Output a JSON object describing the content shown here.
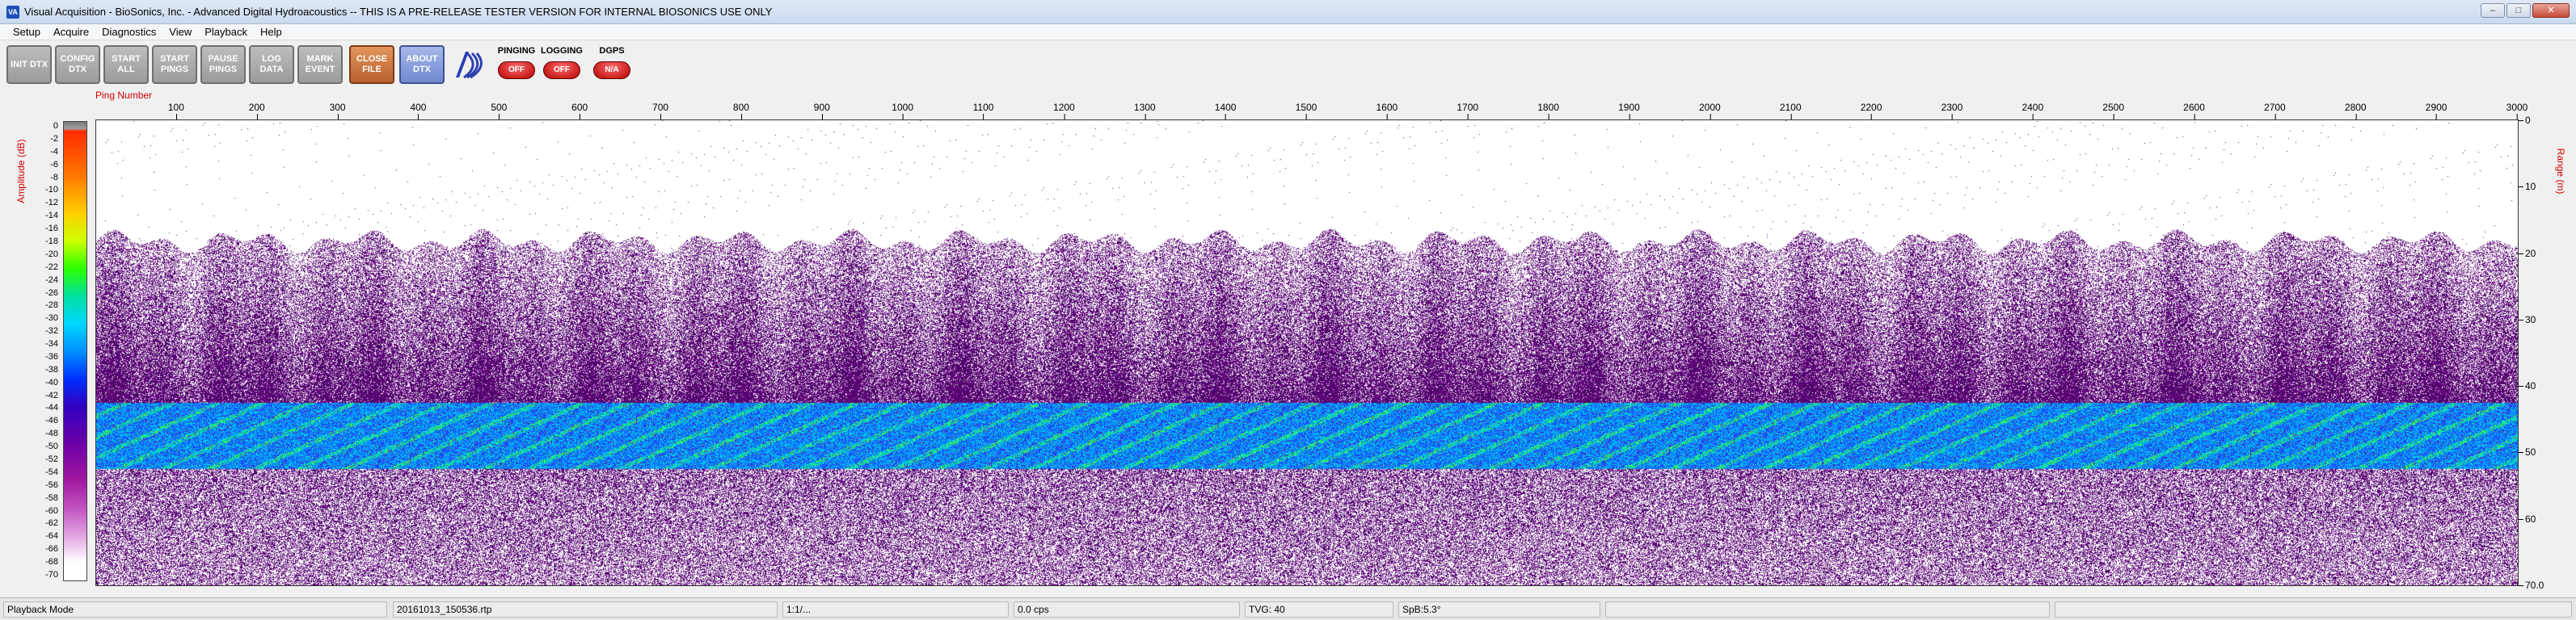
{
  "window": {
    "icon_text": "VA",
    "title": "Visual Acquisition  -  BioSonics, Inc.  -  Advanced Digital Hydroacoustics  --  THIS IS A PRE-RELEASE TESTER VERSION FOR INTERNAL BIOSONICS USE ONLY",
    "controls": [
      "–",
      "□",
      "✕"
    ]
  },
  "menu": [
    "Setup",
    "Acquire",
    "Diagnostics",
    "View",
    "Playback",
    "Help"
  ],
  "toolbar": {
    "buttons": [
      {
        "label": "INIT DTX",
        "name": "init-dtx-button"
      },
      {
        "label": "CONFIG DTX",
        "name": "config-dtx-button"
      },
      {
        "label": "START ALL",
        "name": "start-all-button"
      },
      {
        "label": "START PINGS",
        "name": "start-pings-button"
      },
      {
        "label": "PAUSE PINGS",
        "name": "pause-pings-button"
      },
      {
        "label": "LOG DATA",
        "name": "log-data-button"
      },
      {
        "label": "MARK EVENT",
        "name": "mark-event-button"
      },
      {
        "label": "CLOSE FILE",
        "name": "close-file-button"
      },
      {
        "label": "ABOUT DTX",
        "name": "about-dtx-button"
      }
    ],
    "indicators": [
      {
        "label": "PINGING",
        "value": "OFF"
      },
      {
        "label": "LOGGING",
        "value": "OFF"
      },
      {
        "label": "DGPS",
        "value": "N/A"
      }
    ]
  },
  "plot": {
    "x_axis_title": "Ping Number",
    "y_left_title": "Amplitude (dB)",
    "y_right_title": "Range (m)",
    "x_ticks": [
      "100",
      "200",
      "300",
      "400",
      "500",
      "600",
      "700",
      "800",
      "900",
      "1000",
      "1100",
      "1200",
      "1300",
      "1400",
      "1500",
      "1600",
      "1700",
      "1800",
      "1900",
      "2000",
      "2100",
      "2200",
      "2300",
      "2400",
      "2500",
      "2600",
      "2700",
      "2800",
      "2900",
      "3000"
    ],
    "range_ticks": [
      "0",
      "10",
      "20",
      "30",
      "40",
      "50",
      "60",
      "70.0"
    ],
    "colorbar_ticks": [
      "0",
      "-2",
      "-4",
      "-6",
      "-8",
      "-10",
      "-12",
      "-14",
      "-16",
      "-18",
      "-20",
      "-22",
      "-24",
      "-26",
      "-28",
      "-30",
      "-32",
      "-34",
      "-36",
      "-38",
      "-40",
      "-42",
      "-44",
      "-46",
      "-48",
      "-50",
      "-52",
      "-54",
      "-56",
      "-58",
      "-60",
      "-62",
      "-64",
      "-66",
      "-68",
      "-70"
    ]
  },
  "chart_data": {
    "type": "heatmap",
    "x_range": [
      0,
      3000
    ],
    "range_m": [
      0,
      70
    ],
    "amplitude_db": [
      -70,
      0
    ],
    "xlabel": "Ping Number",
    "ylabel": "Range (m)",
    "colorbar_label": "Amplitude (dB)"
  },
  "statusbar": {
    "mode": "Playback Mode",
    "file": "20161013_150536.rtp",
    "ratio": "1:1/...",
    "rate": "0.0 cps",
    "tvg": "TVG: 40",
    "sp": "SpB:5.3°"
  }
}
